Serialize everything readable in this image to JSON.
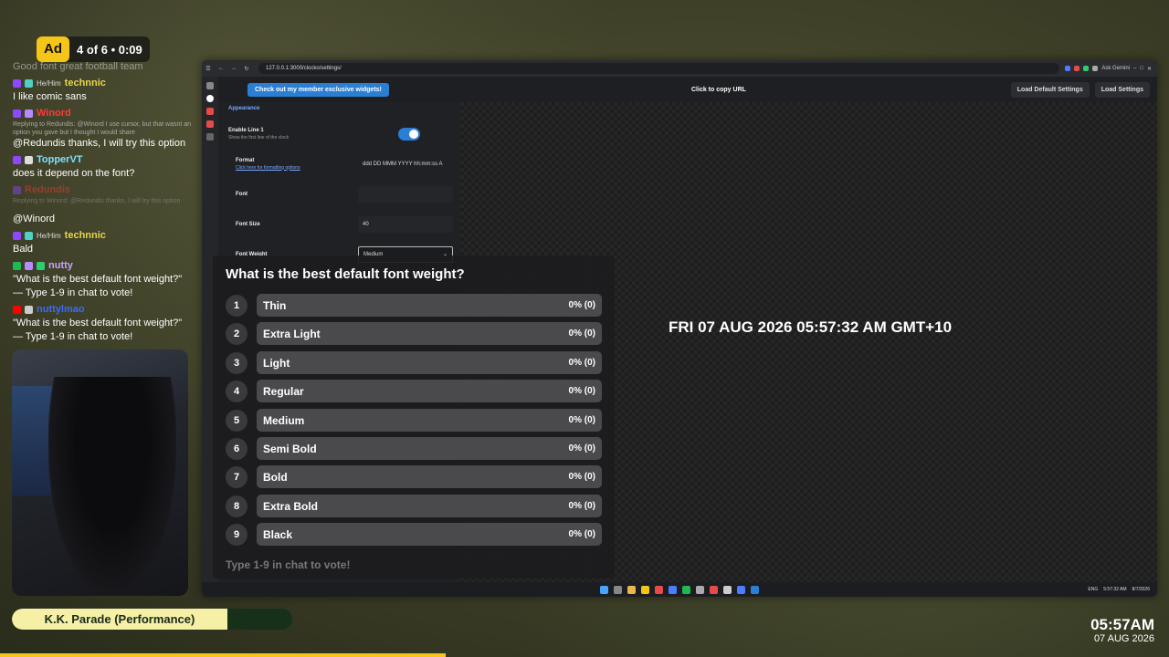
{
  "ad": {
    "badge": "Ad",
    "info": "4 of 6 • 0:09"
  },
  "chat": {
    "partial_top": "Good font great football team",
    "messages": [
      {
        "pronoun": "He/Him",
        "user": "technnic",
        "user_color": "#e8d44d",
        "text": "I like comic sans",
        "reply": ""
      },
      {
        "pronoun": "",
        "user": "Winord",
        "user_color": "#ff3b3b",
        "text": "@Redundis thanks, I will try this option",
        "reply": "Replying to Redundis: @Winord I use cursor, but that wasnt an option you gave but I thought I would share"
      },
      {
        "pronoun": "",
        "user": "TopperVT",
        "user_color": "#7be0ff",
        "text": "does it depend on the font?",
        "reply": ""
      },
      {
        "pronoun": "",
        "user": "Redundis",
        "user_color": "#ff3b3b",
        "text": "",
        "reply": "Replying to Winord: @Redundis thanks, I will try this option"
      },
      {
        "pronoun": "",
        "user": "",
        "user_color": "#ffffff",
        "text": "@Winord",
        "reply": ""
      },
      {
        "pronoun": "He/Him",
        "user": "technnic",
        "user_color": "#e8d44d",
        "text": "Bald",
        "reply": ""
      },
      {
        "pronoun": "",
        "user": "nutty",
        "user_color": "#c7a3ff",
        "text": "\"What is the best default font weight?\" — Type 1-9 in chat to vote!",
        "reply": ""
      },
      {
        "pronoun": "",
        "user": "nuttylmao",
        "user_color": "#3a6bff",
        "text": "\"What is the best default font weight?\" — Type 1-9 in chat to vote!",
        "reply": ""
      }
    ]
  },
  "song": {
    "title": "K.K. Parade (Performance)",
    "progress": 0.77
  },
  "overlay_clock": {
    "time": "05:57AM",
    "date": "07 AUG 2026"
  },
  "browser": {
    "url": "127.0.0.1:3000/clocko/settings/",
    "ask_label": "Ask Gemini",
    "member_button": "Check out my member exclusive widgets!",
    "copy_url": "Click to copy URL",
    "load_default": "Load Default Settings",
    "load_settings": "Load Settings"
  },
  "settings": {
    "section": "Appearance",
    "enable_line": {
      "label": "Enable Line 1",
      "sub": "Show the first line of the clock",
      "checked": true
    },
    "format": {
      "label": "Format",
      "link": "Click here for formatting options",
      "value": "ddd DD MMM YYYY hh:mm:ss A"
    },
    "font": {
      "label": "Font",
      "value": ""
    },
    "font_size": {
      "label": "Font Size",
      "value": "40"
    },
    "font_weight": {
      "label": "Font Weight",
      "value": "Medium"
    }
  },
  "clock_preview": "FRI 07 AUG 2026 05:57:32 AM GMT+10",
  "taskbar": {
    "tray_time": "5:57:32 AM",
    "tray_date": "8/7/2026",
    "tray_label": "ENG"
  },
  "poll": {
    "question": "What is the best default font weight?",
    "options": [
      {
        "num": "1",
        "name": "Thin",
        "pct": "0% (0)"
      },
      {
        "num": "2",
        "name": "Extra Light",
        "pct": "0% (0)"
      },
      {
        "num": "3",
        "name": "Light",
        "pct": "0% (0)"
      },
      {
        "num": "4",
        "name": "Regular",
        "pct": "0% (0)"
      },
      {
        "num": "5",
        "name": "Medium",
        "pct": "0% (0)"
      },
      {
        "num": "6",
        "name": "Semi Bold",
        "pct": "0% (0)"
      },
      {
        "num": "7",
        "name": "Bold",
        "pct": "0% (0)"
      },
      {
        "num": "8",
        "name": "Extra Bold",
        "pct": "0% (0)"
      },
      {
        "num": "9",
        "name": "Black",
        "pct": "0% (0)"
      }
    ],
    "footer": "Type 1-9 in chat to vote!"
  },
  "colors": {
    "accent": "#2a7fd4",
    "ad_yellow": "#f5c518",
    "song_fill": "#f5f0a6"
  }
}
